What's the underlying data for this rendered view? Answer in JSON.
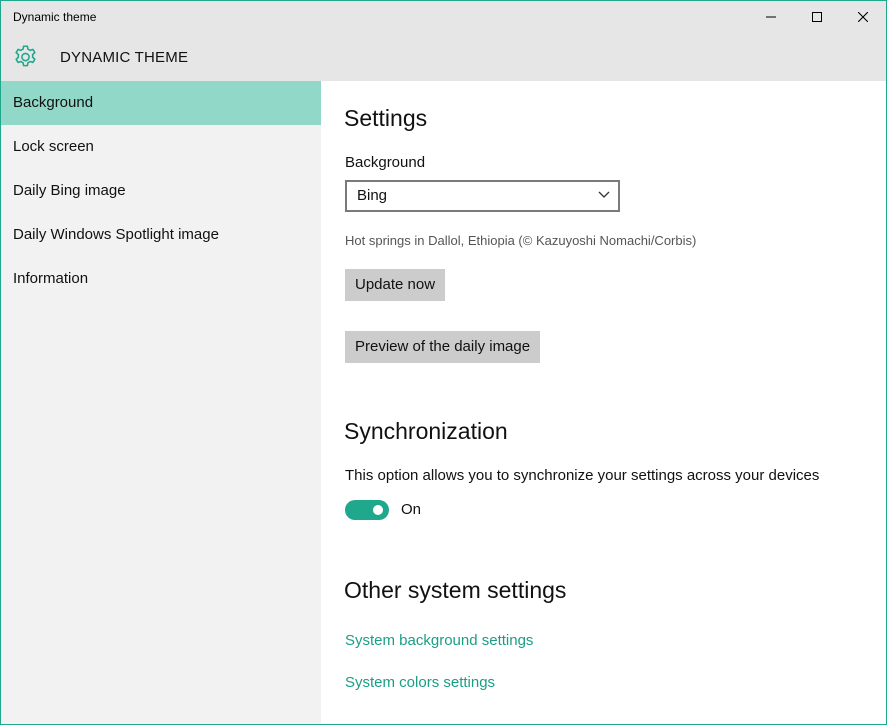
{
  "window": {
    "title": "Dynamic theme"
  },
  "app": {
    "title": "DYNAMIC THEME",
    "accent_color": "#1fa88c",
    "selected_nav_color": "#91d8c9"
  },
  "sidebar": {
    "items": [
      {
        "label": "Background",
        "selected": true
      },
      {
        "label": "Lock screen",
        "selected": false
      },
      {
        "label": "Daily Bing image",
        "selected": false
      },
      {
        "label": "Daily Windows Spotlight image",
        "selected": false
      },
      {
        "label": "Information",
        "selected": false
      }
    ]
  },
  "settings": {
    "heading": "Settings",
    "background_label": "Background",
    "background_value": "Bing",
    "image_caption": "Hot springs in Dallol, Ethiopia (© Kazuyoshi Nomachi/Corbis)",
    "update_button": "Update now",
    "preview_button": "Preview of the daily image"
  },
  "sync": {
    "heading": "Synchronization",
    "description": "This option allows you to synchronize your settings across your devices",
    "toggle_state": "On"
  },
  "other": {
    "heading": "Other system settings",
    "link_background": "System background settings",
    "link_colors": "System colors settings"
  }
}
